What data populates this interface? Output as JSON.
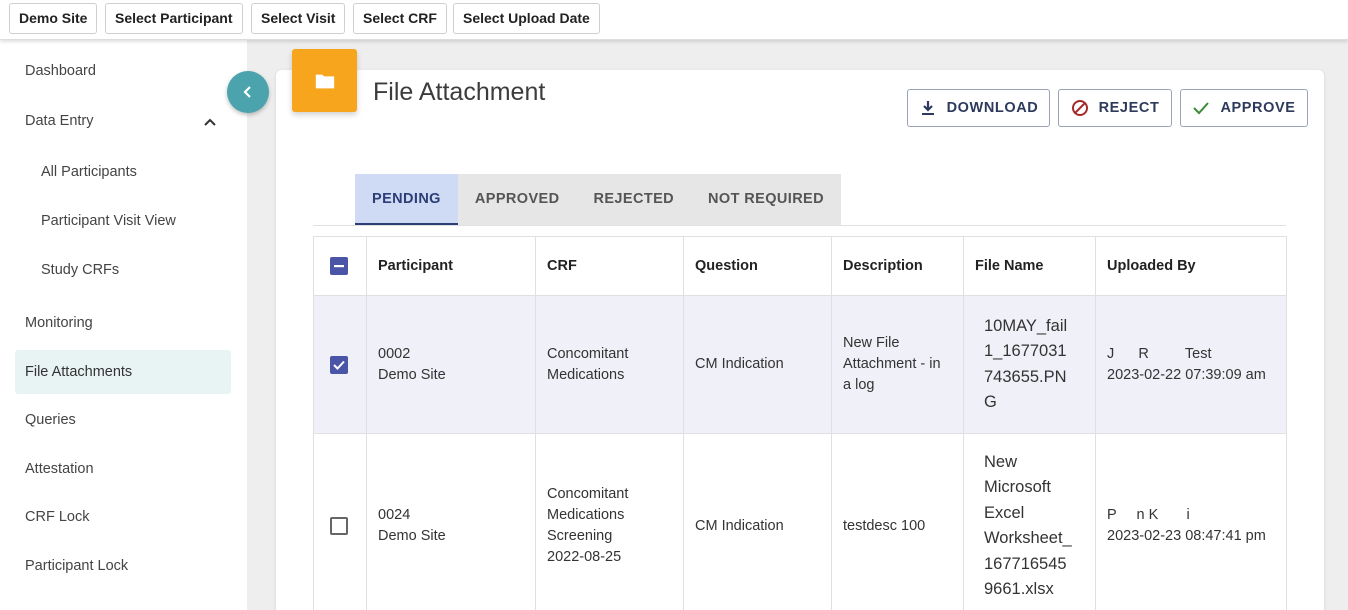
{
  "filters": [
    "Demo Site",
    "Select Participant",
    "Select Visit",
    "Select CRF",
    "Select Upload Date"
  ],
  "sidebar": {
    "items": [
      {
        "label": "Dashboard"
      },
      {
        "label": "Data Entry"
      },
      {
        "label": "All Participants"
      },
      {
        "label": "Participant Visit View"
      },
      {
        "label": "Study CRFs"
      },
      {
        "label": "Monitoring"
      },
      {
        "label": "File Attachments"
      },
      {
        "label": "Queries"
      },
      {
        "label": "Attestation"
      },
      {
        "label": "CRF Lock"
      },
      {
        "label": "Participant Lock"
      }
    ]
  },
  "page": {
    "title": "File Attachment",
    "accent": "#f7a51c"
  },
  "actions": {
    "download": "DOWNLOAD",
    "reject": "REJECT",
    "approve": "APPROVE"
  },
  "tabs": [
    "PENDING",
    "APPROVED",
    "REJECTED",
    "NOT REQUIRED"
  ],
  "table": {
    "columns": [
      "Participant",
      "CRF",
      "Question",
      "Description",
      "File Name",
      "Uploaded By"
    ],
    "rows": [
      {
        "checked": true,
        "participant_id": "0002",
        "participant_site": "Demo Site",
        "crf": [
          "Concomitant",
          "Medications"
        ],
        "question": "CM Indication",
        "description": [
          "New File",
          "Attachment - in",
          "a log"
        ],
        "file_name": [
          "10MAY_fail",
          "1_1677031",
          "743655.PN",
          "G"
        ],
        "uploaded_by": "J      R         Test",
        "uploaded_at": "2023-02-22 07:39:09 am"
      },
      {
        "checked": false,
        "participant_id": "0024",
        "participant_site": "Demo Site",
        "crf": [
          "Concomitant",
          "Medications",
          "Screening",
          "2022-08-25"
        ],
        "question": "CM Indication",
        "description": [
          "testdesc 100"
        ],
        "file_name": [
          "New",
          "Microsoft",
          "Excel",
          "Worksheet_",
          "167716545",
          "9661.xlsx"
        ],
        "uploaded_by": "P     n K       i",
        "uploaded_at": "2023-02-23 08:47:41 pm"
      }
    ]
  }
}
